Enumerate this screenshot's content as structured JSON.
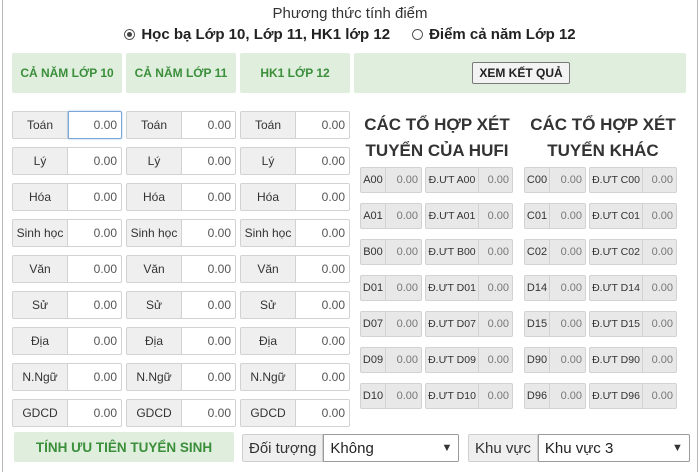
{
  "header": {
    "title": "Phương thức tính điểm",
    "options": [
      {
        "label": "Học bạ Lớp 10, Lớp 11, HK1 lớp 12",
        "checked": true
      },
      {
        "label": "Điểm cả năm Lớp 12",
        "checked": false
      }
    ]
  },
  "columns": [
    {
      "heading": "CẢ NĂM LỚP 10"
    },
    {
      "heading": "CẢ NĂM LỚP 11"
    },
    {
      "heading": "HK1 LỚP 12"
    }
  ],
  "result_button": "XEM KẾT QUẢ",
  "subjects": [
    "Toán",
    "Lý",
    "Hóa",
    "Sinh học",
    "Văn",
    "Sử",
    "Địa",
    "N.Ngữ",
    "GDCD"
  ],
  "score_value": "0.00",
  "hufi": {
    "title_line1": "CÁC TỔ HỢP XÉT",
    "title_line2": "TUYỂN CỦA HUFI",
    "rows": [
      {
        "code": "A00",
        "value": "0.00",
        "priority_label": "Đ.ƯT A00",
        "priority_value": "0.00"
      },
      {
        "code": "A01",
        "value": "0.00",
        "priority_label": "Đ.ƯT A01",
        "priority_value": "0.00"
      },
      {
        "code": "B00",
        "value": "0.00",
        "priority_label": "Đ.ƯT B00",
        "priority_value": "0.00"
      },
      {
        "code": "D01",
        "value": "0.00",
        "priority_label": "Đ.ƯT D01",
        "priority_value": "0.00"
      },
      {
        "code": "D07",
        "value": "0.00",
        "priority_label": "Đ.ƯT D07",
        "priority_value": "0.00"
      },
      {
        "code": "D09",
        "value": "0.00",
        "priority_label": "Đ.ƯT D09",
        "priority_value": "0.00"
      },
      {
        "code": "D10",
        "value": "0.00",
        "priority_label": "Đ.ƯT D10",
        "priority_value": "0.00"
      }
    ]
  },
  "other": {
    "title_line1": "CÁC TỔ HỢP XÉT",
    "title_line2": "TUYỂN KHÁC",
    "rows": [
      {
        "code": "C00",
        "value": "0.00",
        "priority_label": "Đ.ƯT C00",
        "priority_value": "0.00"
      },
      {
        "code": "C01",
        "value": "0.00",
        "priority_label": "Đ.ƯT C01",
        "priority_value": "0.00"
      },
      {
        "code": "C02",
        "value": "0.00",
        "priority_label": "Đ.ƯT C02",
        "priority_value": "0.00"
      },
      {
        "code": "D14",
        "value": "0.00",
        "priority_label": "Đ.ƯT D14",
        "priority_value": "0.00"
      },
      {
        "code": "D15",
        "value": "0.00",
        "priority_label": "Đ.ƯT D15",
        "priority_value": "0.00"
      },
      {
        "code": "D90",
        "value": "0.00",
        "priority_label": "Đ.ƯT D90",
        "priority_value": "0.00"
      },
      {
        "code": "D96",
        "value": "0.00",
        "priority_label": "Đ.ƯT D96",
        "priority_value": "0.00"
      }
    ]
  },
  "priority_section": {
    "title": "TÍNH ƯU TIÊN TUYỂN SINH",
    "object_label": "Đối tượng",
    "object_value": "Không",
    "region_label": "Khu vực",
    "region_value": "Khu vực 3"
  }
}
